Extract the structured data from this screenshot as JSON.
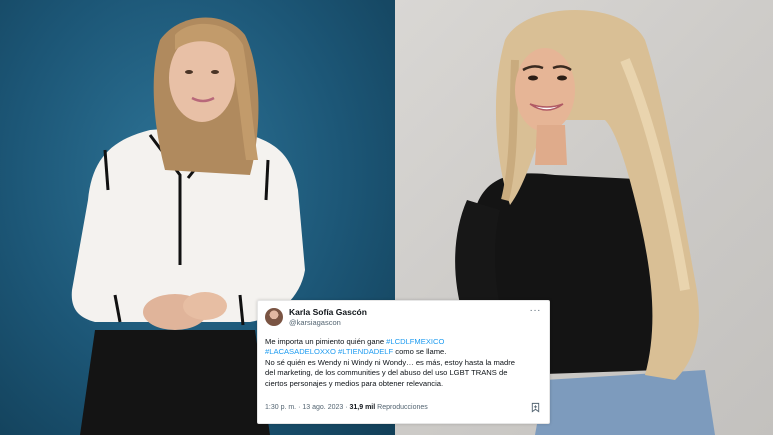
{
  "tweet": {
    "author_name": "Karla Sofía Gascón",
    "author_handle": "@karsiagascon",
    "more_icon": "more-horizontal-icon",
    "lines": [
      [
        {
          "text": "Me importa un pimiento quién gane ",
          "hashtag": false
        },
        {
          "text": "#LCDLFMEXICO",
          "hashtag": true
        }
      ],
      [
        {
          "text": "#LACASADELOXXO",
          "hashtag": true
        },
        {
          "text": " ",
          "hashtag": false
        },
        {
          "text": "#LTIENDADELF",
          "hashtag": true
        },
        {
          "text": " como se llame.",
          "hashtag": false
        }
      ],
      [
        {
          "text": "No sé quién es Wendy ni Windy ni Wondy… es más, estoy hasta la madre",
          "hashtag": false
        }
      ],
      [
        {
          "text": "del marketing, de los communities y del abuso del uso LGBT TRANS de",
          "hashtag": false
        }
      ],
      [
        {
          "text": "ciertos personajes y medios para obtener relevancia.",
          "hashtag": false
        }
      ]
    ],
    "time": "1:30 p. m.",
    "separator": "·",
    "date": "13 ago. 2023",
    "views_count": "31,9 mil",
    "views_label": "Reproducciones",
    "bookmark_icon": "bookmark-icon"
  },
  "colors": {
    "left_background": "#1f5a78",
    "right_background": "#d3d1ce",
    "hashtag": "#1d9bf0",
    "text_primary": "#0f1419",
    "text_secondary": "#536471"
  }
}
